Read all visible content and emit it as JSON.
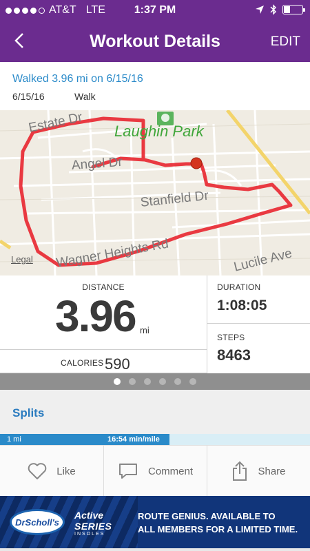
{
  "status_bar": {
    "carrier": "AT&T",
    "network": "LTE",
    "time": "1:37 PM",
    "signal_bars": 4,
    "signal_total": 5,
    "battery_level": 0.35
  },
  "nav": {
    "title": "Workout Details",
    "edit_label": "EDIT",
    "back_icon": "chevron-left-icon"
  },
  "summary": {
    "headline": "Walked 3.96 mi on 6/15/16",
    "date": "6/15/16",
    "activity": "Walk"
  },
  "map": {
    "park_label": "Laughin Park",
    "streets": [
      "Estate Dr",
      "Angel Dr",
      "Stanfield Dr",
      "Wagner Heights Rd",
      "Lucile Ave"
    ],
    "legal_label": "Legal",
    "route_color": "#e8262f",
    "park_color": "#3fa63a"
  },
  "stats": {
    "distance_label": "DISTANCE",
    "distance_value": "3.96",
    "distance_unit": "mi",
    "calories_label": "CALORIES",
    "calories_value": "590",
    "duration_label": "DURATION",
    "duration_value": "1:08:05",
    "steps_label": "STEPS",
    "steps_value": "8463"
  },
  "pager": {
    "count": 6,
    "active_index": 0
  },
  "splits": {
    "title": "Splits",
    "rows": [
      {
        "mile": "1 mi",
        "pace": "16:54 min/mile"
      }
    ]
  },
  "actions": {
    "like_label": "Like",
    "comment_label": "Comment",
    "share_label": "Share"
  },
  "ad": {
    "logo_text": "DrScholl's",
    "brand_line1": "Active",
    "brand_line2": "SERIES",
    "brand_line3": "INSOLES",
    "message_line1": "ROUTE GENIUS. AVAILABLE TO",
    "message_line2": "ALL MEMBERS FOR A LIMITED TIME."
  },
  "colors": {
    "header_purple": "#6b2c8f",
    "link_blue": "#2a8ac9"
  }
}
